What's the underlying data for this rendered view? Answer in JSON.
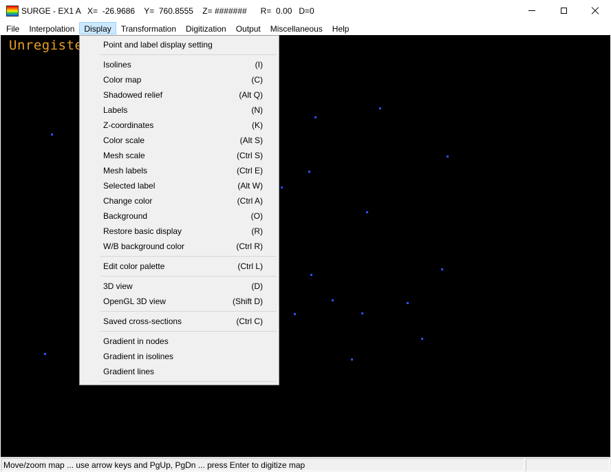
{
  "window": {
    "title": "SURGE - EX1 A   X=  -26.9686    Y=  760.8555    Z= #######      R=  0.00   D=0",
    "controls": {
      "minimize": "minimize",
      "maximize": "maximize",
      "close": "close"
    }
  },
  "menubar": {
    "items": [
      "File",
      "Interpolation",
      "Display",
      "Transformation",
      "Digitization",
      "Output",
      "Miscellaneous",
      "Help"
    ],
    "active": "Display"
  },
  "canvas": {
    "overlay_text": "Unregiste",
    "point_color": "#2a52ff",
    "background": "#000000"
  },
  "display_menu": {
    "groups": [
      [
        {
          "label": "Point and label display setting",
          "shortcut": ""
        }
      ],
      [
        {
          "label": "Isolines",
          "shortcut": "(I)"
        },
        {
          "label": "Color map",
          "shortcut": "(C)"
        },
        {
          "label": "Shadowed relief",
          "shortcut": "(Alt Q)"
        },
        {
          "label": "Labels",
          "shortcut": "(N)"
        },
        {
          "label": "Z-coordinates",
          "shortcut": "(K)"
        },
        {
          "label": "Color scale",
          "shortcut": "(Alt S)"
        },
        {
          "label": "Mesh scale",
          "shortcut": "(Ctrl S)"
        },
        {
          "label": "Mesh labels",
          "shortcut": "(Ctrl E)"
        },
        {
          "label": "Selected label",
          "shortcut": "(Alt W)"
        },
        {
          "label": "Change color",
          "shortcut": "(Ctrl A)"
        },
        {
          "label": "Background",
          "shortcut": "(O)"
        },
        {
          "label": "Restore basic display",
          "shortcut": "(R)"
        },
        {
          "label": "W/B background color",
          "shortcut": "(Ctrl R)"
        }
      ],
      [
        {
          "label": "Edit color palette",
          "shortcut": "(Ctrl L)"
        }
      ],
      [
        {
          "label": "3D view",
          "shortcut": "(D)"
        },
        {
          "label": "OpenGL 3D view",
          "shortcut": "(Shift D)"
        }
      ],
      [
        {
          "label": "Saved cross-sections",
          "shortcut": "(Ctrl C)"
        }
      ],
      [
        {
          "label": "Gradient in nodes",
          "shortcut": ""
        },
        {
          "label": "Gradient in isolines",
          "shortcut": ""
        },
        {
          "label": "Gradient lines",
          "shortcut": ""
        }
      ]
    ]
  },
  "statusbar": {
    "text": "Move/zoom map ... use arrow keys and PgUp, PgDn ... press Enter to digitize map"
  }
}
